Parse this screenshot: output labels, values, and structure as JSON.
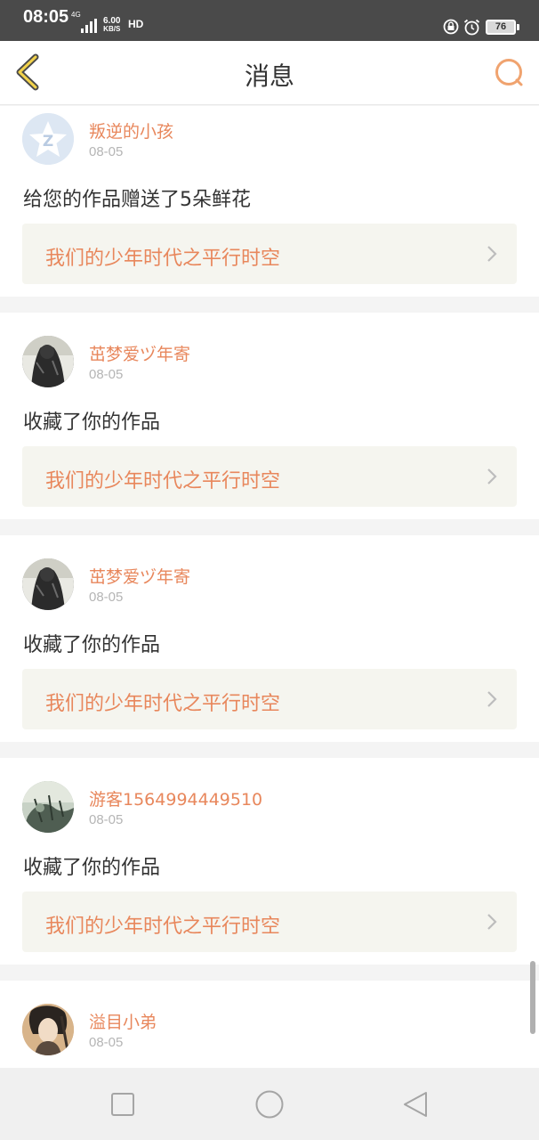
{
  "status_bar": {
    "time": "08:05",
    "network": "4G",
    "speed_value": "6.00",
    "speed_unit": "KB/S",
    "hd": "HD",
    "battery": "76"
  },
  "header": {
    "title": "消息",
    "back_icon": "chevron-left-icon",
    "search_icon": "search-icon"
  },
  "messages": [
    {
      "user": "叛逆的小孩",
      "date": "08-05",
      "action": "给您的作品赠送了5朵鲜花",
      "work": "我们的少年时代之平行时空",
      "avatar_icon": "default-avatar-icon"
    },
    {
      "user": "茁梦爱ヅ年寄",
      "date": "08-05",
      "action": "收藏了你的作品",
      "work": "我们的少年时代之平行时空",
      "avatar_icon": "user-photo-avatar"
    },
    {
      "user": "茁梦爱ヅ年寄",
      "date": "08-05",
      "action": "收藏了你的作品",
      "work": "我们的少年时代之平行时空",
      "avatar_icon": "user-photo-avatar"
    },
    {
      "user": "游客1564994449510",
      "date": "08-05",
      "action": "收藏了你的作品",
      "work": "我们的少年时代之平行时空",
      "avatar_icon": "user-photo-avatar"
    },
    {
      "user": "溢目小弟",
      "date": "08-05",
      "action": "",
      "work": "",
      "avatar_icon": "user-photo-avatar"
    }
  ],
  "navigation_bar": {
    "items": [
      "recent-apps-icon",
      "home-icon",
      "back-triangle-icon"
    ]
  },
  "colors": {
    "accent": "#e8875c",
    "status_bar": "#4a4a4a",
    "card_bg": "#ffffff",
    "work_bg": "#f5f5ef"
  }
}
